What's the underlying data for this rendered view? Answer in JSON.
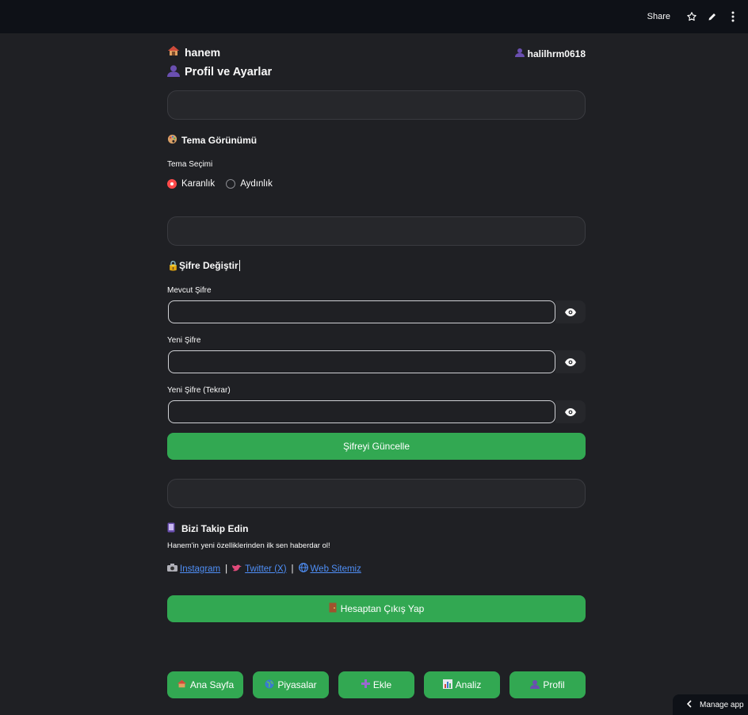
{
  "topbar": {
    "share_label": "Share",
    "icons": [
      "star-icon",
      "pencil-icon",
      "more-vert-icon"
    ]
  },
  "header": {
    "brand": "hanem",
    "username": "halilhrm0618",
    "page_title": "Profil ve Ayarlar"
  },
  "theme": {
    "heading": "Tema Görünümü",
    "label": "Tema Seçimi",
    "options": [
      "Karanlık",
      "Aydınlık"
    ],
    "selected": "Karanlık"
  },
  "password": {
    "heading": "🔒Şifre Değiştir",
    "current_label": "Mevcut Şifre",
    "new_label": "Yeni Şifre",
    "repeat_label": "Yeni Şifre (Tekrar)",
    "current_value": "",
    "new_value": "",
    "repeat_value": "",
    "update_button": "Şifreyi Güncelle"
  },
  "follow": {
    "heading": "Bizi Takip Edin",
    "note": "Hanem'in yeni özelliklerinden ilk sen haberdar ol!",
    "instagram": "Instagram",
    "twitter": "Twitter (X)",
    "website": "Web Sitemiz",
    "separator": "|"
  },
  "logout_button": "Hesaptan Çıkış Yap",
  "nav": {
    "home": "Ana Sayfa",
    "markets": "Piyasalar",
    "add": "Ekle",
    "analysis": "Analiz",
    "profile": "Profil"
  },
  "manage_app": "Manage app",
  "colors": {
    "accent_green": "#32a852",
    "radio_red": "#ff4b4b",
    "link_blue": "#4f8ff7",
    "background": "#1f2024"
  }
}
